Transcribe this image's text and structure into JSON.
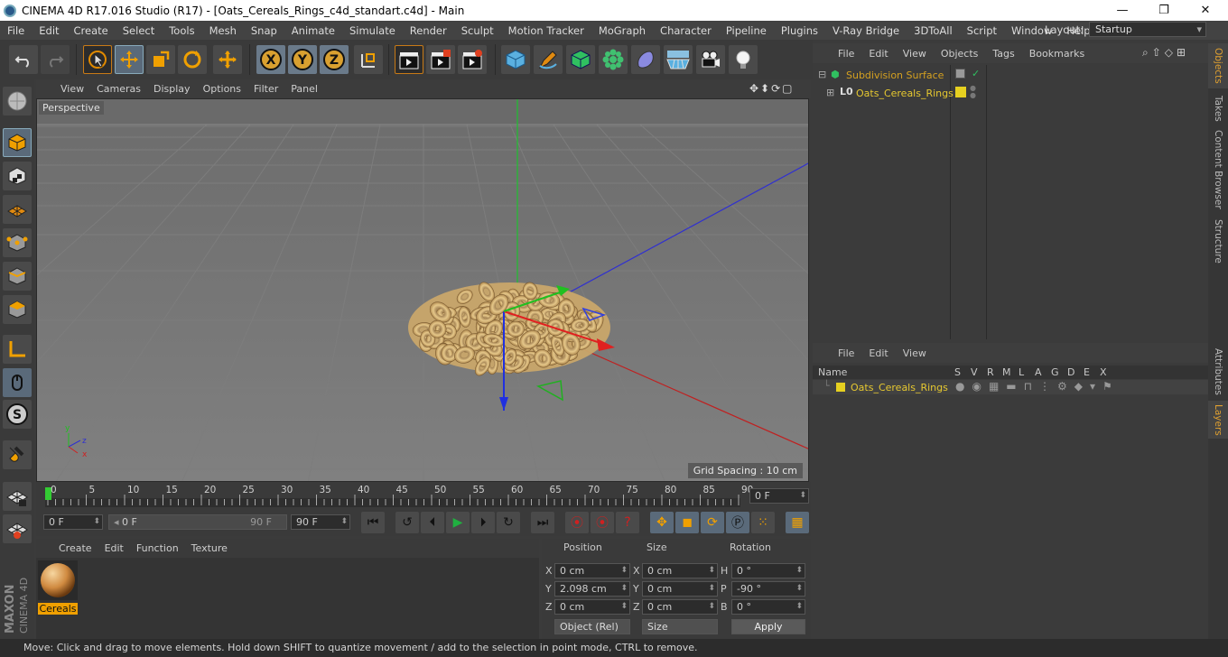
{
  "window": {
    "title": "CINEMA 4D R17.016 Studio (R17) - [Oats_Cereals_Rings_c4d_standart.c4d] - Main",
    "minimize": "—",
    "maximize": "❐",
    "close": "✕"
  },
  "menubar": {
    "items": [
      "File",
      "Edit",
      "Create",
      "Select",
      "Tools",
      "Mesh",
      "Snap",
      "Animate",
      "Simulate",
      "Render",
      "Sculpt",
      "Motion Tracker",
      "MoGraph",
      "Character",
      "Pipeline",
      "Plugins",
      "V-Ray Bridge",
      "3DToAll",
      "Script",
      "Window",
      "Help"
    ],
    "layout_label": "Layout:",
    "layout_value": "Startup"
  },
  "toolbar": {
    "icons": [
      "undo-icon",
      "redo-icon",
      "live-select-icon",
      "move-icon",
      "scale-icon",
      "rotate-icon",
      "transform-icon",
      "x-axis-icon",
      "y-axis-icon",
      "z-axis-icon",
      "coordinate-system-icon",
      "render-view-icon",
      "render-picture-viewer-icon",
      "render-settings-icon",
      "cube-icon",
      "pen-icon",
      "subdivision-icon",
      "cloner-icon",
      "deformer-icon",
      "floor-icon",
      "camera-icon",
      "light-icon"
    ],
    "axis_x": "X",
    "axis_y": "Y",
    "axis_z": "Z"
  },
  "viewport": {
    "menu": [
      "View",
      "Cameras",
      "Display",
      "Options",
      "Filter",
      "Panel"
    ],
    "label": "Perspective",
    "grid_spacing": "Grid Spacing : 10 cm",
    "axis_y": "y",
    "axis_z": "z",
    "axis_x": "x"
  },
  "timeline": {
    "ticks": [
      "0",
      "5",
      "10",
      "15",
      "20",
      "25",
      "30",
      "35",
      "40",
      "45",
      "50",
      "55",
      "60",
      "65",
      "70",
      "75",
      "80",
      "85",
      "90"
    ],
    "end_field": "0 F"
  },
  "transport": {
    "start_field": "0 F",
    "range_start": "0 F",
    "range_end": "90 F",
    "end_field": "90 F"
  },
  "material_panel": {
    "menu": [
      "Create",
      "Edit",
      "Function",
      "Texture"
    ],
    "material_name": "Cereals"
  },
  "coordinates": {
    "headers": [
      "Position",
      "Size",
      "Rotation"
    ],
    "rows": [
      {
        "pos_label": "X",
        "pos": "0 cm",
        "size_label": "X",
        "size": "0 cm",
        "rot_label": "H",
        "rot": "0 °"
      },
      {
        "pos_label": "Y",
        "pos": "2.098 cm",
        "size_label": "Y",
        "size": "0 cm",
        "rot_label": "P",
        "rot": "-90 °"
      },
      {
        "pos_label": "Z",
        "pos": "0 cm",
        "size_label": "Z",
        "size": "0 cm",
        "rot_label": "B",
        "rot": "0 °"
      }
    ],
    "mode": "Object (Rel)",
    "size_mode": "Size",
    "apply": "Apply"
  },
  "objects_panel": {
    "menu": [
      "File",
      "Edit",
      "View",
      "Objects",
      "Tags",
      "Bookmarks"
    ],
    "items": [
      {
        "name": "Subdivision Surface",
        "color": "#d4a020"
      },
      {
        "name": "Oats_Cereals_Rings",
        "color": "#e6c830"
      }
    ]
  },
  "layers_panel": {
    "menu": [
      "File",
      "Edit",
      "View"
    ],
    "columns": [
      "Name",
      "S",
      "V",
      "R",
      "M",
      "L",
      "A",
      "G",
      "D",
      "E",
      "X"
    ],
    "layer_name": "Oats_Cereals_Rings",
    "layer_color": "#e6d020"
  },
  "side_tabs": [
    "Objects",
    "Takes",
    "Content Browser",
    "Structure",
    "Attributes",
    "Layers"
  ],
  "status": "Move: Click and drag to move elements. Hold down SHIFT to quantize movement / add to the selection in point mode, CTRL to remove.",
  "colors": {
    "accent": "#f0a000",
    "selection": "#c87a16",
    "bg": "#3b3b3b"
  }
}
